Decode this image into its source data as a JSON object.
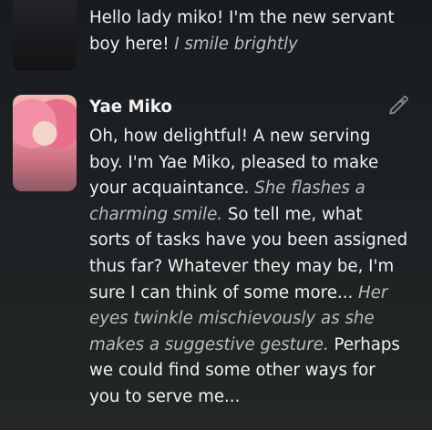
{
  "messages": [
    {
      "author": "user",
      "text": "Hello lady miko! I'm the new servant boy here! ",
      "action": "I smile brightly"
    },
    {
      "author": "Yae Miko",
      "segments": {
        "s1": "Oh, how delightful! A new serving boy. I'm Yae Miko, pleased to make your acquaintance. ",
        "a1": "She flashes a charming smile.",
        "s2": " So tell me, what sorts of tasks have you been assigned thus far? Whatever they may be, I'm sure I can think of some more... ",
        "a2": "Her eyes twinkle mischievously as she makes a suggestive gesture.",
        "s3": " Perhaps we could find some other ways for you to serve me..."
      }
    }
  ],
  "icons": {
    "edit": "pencil-icon"
  }
}
